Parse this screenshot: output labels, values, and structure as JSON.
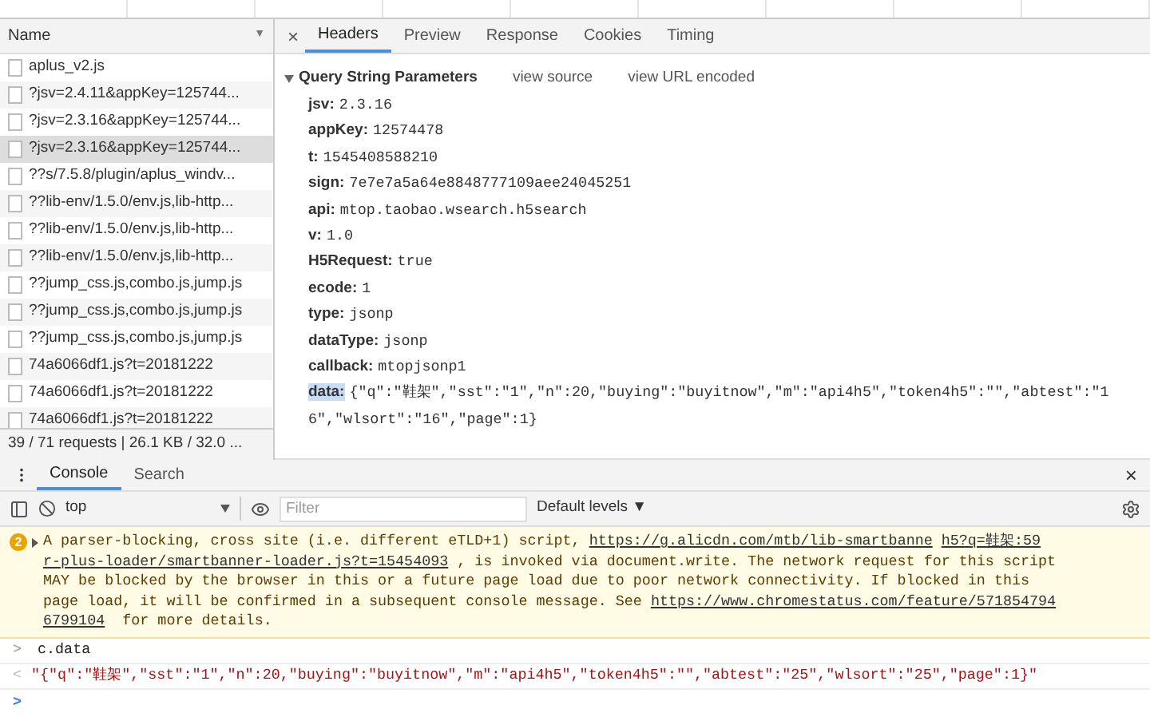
{
  "network": {
    "name_column": {
      "label": "Name",
      "sort_icon": "▼"
    },
    "requests": [
      {
        "name": "aplus_v2.js",
        "selected": false
      },
      {
        "name": "?jsv=2.4.11&appKey=125744...",
        "selected": false
      },
      {
        "name": "?jsv=2.3.16&appKey=125744...",
        "selected": false
      },
      {
        "name": "?jsv=2.3.16&appKey=125744...",
        "selected": true
      },
      {
        "name": "??s/7.5.8/plugin/aplus_windv...",
        "selected": false
      },
      {
        "name": "??lib-env/1.5.0/env.js,lib-http...",
        "selected": false
      },
      {
        "name": "??lib-env/1.5.0/env.js,lib-http...",
        "selected": false
      },
      {
        "name": "??lib-env/1.5.0/env.js,lib-http...",
        "selected": false
      },
      {
        "name": "??jump_css.js,combo.js,jump.js",
        "selected": false
      },
      {
        "name": "??jump_css.js,combo.js,jump.js",
        "selected": false
      },
      {
        "name": "??jump_css.js,combo.js,jump.js",
        "selected": false
      },
      {
        "name": "74a6066df1.js?t=20181222",
        "selected": false
      },
      {
        "name": "74a6066df1.js?t=20181222",
        "selected": false
      },
      {
        "name": "74a6066df1.js?t=20181222",
        "selected": false
      }
    ],
    "summary": "39 / 71 requests | 26.1 KB / 32.0 ..."
  },
  "details": {
    "close": "×",
    "tabs": [
      {
        "label": "Headers",
        "selected": true
      },
      {
        "label": "Preview",
        "selected": false
      },
      {
        "label": "Response",
        "selected": false
      },
      {
        "label": "Cookies",
        "selected": false
      },
      {
        "label": "Timing",
        "selected": false
      }
    ],
    "section": {
      "title": "Query String Parameters",
      "expanded": true,
      "links": [
        "view source",
        "view URL encoded"
      ]
    },
    "params": [
      {
        "key": "jsv:",
        "value": "2.3.16",
        "highlighted": false
      },
      {
        "key": "appKey:",
        "value": "12574478",
        "highlighted": false
      },
      {
        "key": "t:",
        "value": "1545408588210",
        "highlighted": false
      },
      {
        "key": "sign:",
        "value": "7e7e7a5a64e8848777109aee24045251",
        "highlighted": false
      },
      {
        "key": "api:",
        "value": "mtop.taobao.wsearch.h5search",
        "highlighted": false
      },
      {
        "key": "v:",
        "value": "1.0",
        "highlighted": false
      },
      {
        "key": "H5Request:",
        "value": "true",
        "highlighted": false
      },
      {
        "key": "ecode:",
        "value": "1",
        "highlighted": false
      },
      {
        "key": "type:",
        "value": "jsonp",
        "highlighted": false
      },
      {
        "key": "dataType:",
        "value": "jsonp",
        "highlighted": false
      },
      {
        "key": "callback:",
        "value": "mtopjsonp1",
        "highlighted": false
      },
      {
        "key": "data:",
        "value": "{\"q\":\"鞋架\",\"sst\":\"1\",\"n\":20,\"buying\":\"buyitnow\",\"m\":\"api4h5\",\"token4h5\":\"\",\"abtest\":\"16\",\"wlsort\":\"16\",\"page\":1}",
        "highlighted": true
      }
    ]
  },
  "drawer": {
    "tabs": [
      {
        "label": "Console",
        "selected": true
      },
      {
        "label": "Search",
        "selected": false
      }
    ],
    "close": "×",
    "context": "top",
    "filter_placeholder": "Filter",
    "levels": "Default levels ▼",
    "warning": {
      "count": "2",
      "lines": [
        [
          {
            "text": "A parser-blocking, cross site (i.e. different eTLD+1) script, "
          },
          {
            "text": "https://g.alicdn.com/mtb/lib-smartbanne",
            "link": true
          },
          {
            "text": "h5?q=鞋架:59",
            "link": true
          }
        ],
        [
          {
            "text": "r-plus-loader/smartbanner-loader.js?t=15454093",
            "link": true
          },
          {
            "text": ", is invoked via document.write. The network request for this script"
          }
        ],
        [
          {
            "text": "MAY be blocked by the browser in this or a future page load due to poor network connectivity. If blocked in this"
          }
        ],
        [
          {
            "text": "page load, it will be confirmed in a subsequent console message. See "
          },
          {
            "text": "https://www.chromestatus.com/feature/571854794",
            "link": true
          }
        ],
        [
          {
            "text": "6799104",
            "link": true
          },
          {
            "text": " for more details."
          }
        ]
      ]
    },
    "entries": [
      {
        "kind": "input",
        "prompt": ">",
        "text": "c.data"
      },
      {
        "kind": "result",
        "prompt": "<",
        "text": "\"{\"q\":\"鞋架\",\"sst\":\"1\",\"n\":20,\"buying\":\"buyitnow\",\"m\":\"api4h5\",\"token4h5\":\"\",\"abtest\":\"25\",\"wlsort\":\"25\",\"page\":1}\""
      },
      {
        "kind": "prompt",
        "prompt": ">"
      }
    ]
  }
}
